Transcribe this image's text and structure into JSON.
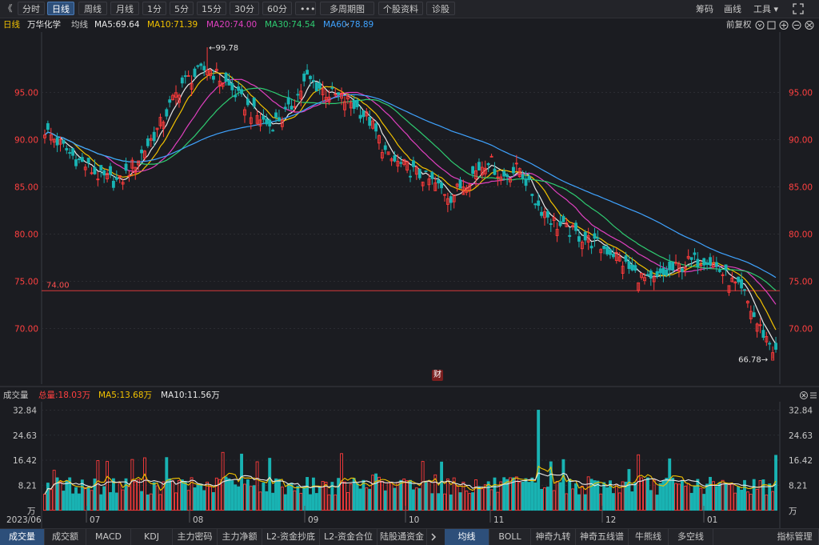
{
  "toolbar": {
    "back": "《",
    "periods": [
      "分时",
      "日线",
      "周线",
      "月线",
      "1分",
      "5分",
      "15分",
      "30分",
      "60分",
      "•••",
      "多周期图 ⌄",
      "个股资料",
      "诊股"
    ],
    "active_period": "日线",
    "right_items": [
      "筹码",
      "画线",
      "工具 ▾"
    ]
  },
  "header": {
    "period": "日线",
    "stock_name": "万华化学",
    "ma_label": "均线",
    "ma_values": [
      {
        "text": "MA5:69.64",
        "color": "#e8e8e8"
      },
      {
        "text": "MA10:71.39",
        "color": "#f2c200"
      },
      {
        "text": "MA20:74.00",
        "color": "#e040c0"
      },
      {
        "text": "MA30:74.54",
        "color": "#2ecc71"
      },
      {
        "text": "MA60:78.89",
        "color": "#3fa3ff"
      }
    ],
    "adjust": "前复权"
  },
  "price_axis": {
    "labels": [
      "95.00",
      "90.00",
      "85.00",
      "80.00",
      "75.00",
      "70.00"
    ],
    "min": 66.78,
    "max": 99.78,
    "ref_line_label": "74.00",
    "ref_line_value": 74.0,
    "high_label": "99.78",
    "low_label": "66.78",
    "marker": "财"
  },
  "volume_header": {
    "title": "成交量",
    "total": "总量:18.03万",
    "ma5": "MA5:13.68万",
    "ma10": "MA10:11.56万"
  },
  "volume_axis": {
    "labels": [
      "32.84",
      "24.63",
      "16.42",
      "8.21"
    ],
    "unit": "万"
  },
  "x_axis": {
    "labels": [
      "2023/06",
      "07",
      "08",
      "09",
      "10",
      "11",
      "12",
      "01"
    ]
  },
  "bottom_tabs_left": [
    "成交量",
    "成交额",
    "MACD",
    "KDJ",
    "主力密码",
    "主力净额",
    "L2-资金抄底",
    "L2-资金合位",
    "陆股通资金"
  ],
  "bottom_tabs_right": [
    "均线",
    "BOLL",
    "神奇九转",
    "神奇五线谱",
    "牛熊线",
    "多空线",
    "指标管理"
  ],
  "colors": {
    "up": "#ff3b3b",
    "down": "#19b3b3",
    "ma5": "#e8e8e8",
    "ma10": "#f2c200",
    "ma20": "#e040c0",
    "ma30": "#2ecc71",
    "ma60": "#3fa3ff",
    "axis": "#ff4040"
  }
}
